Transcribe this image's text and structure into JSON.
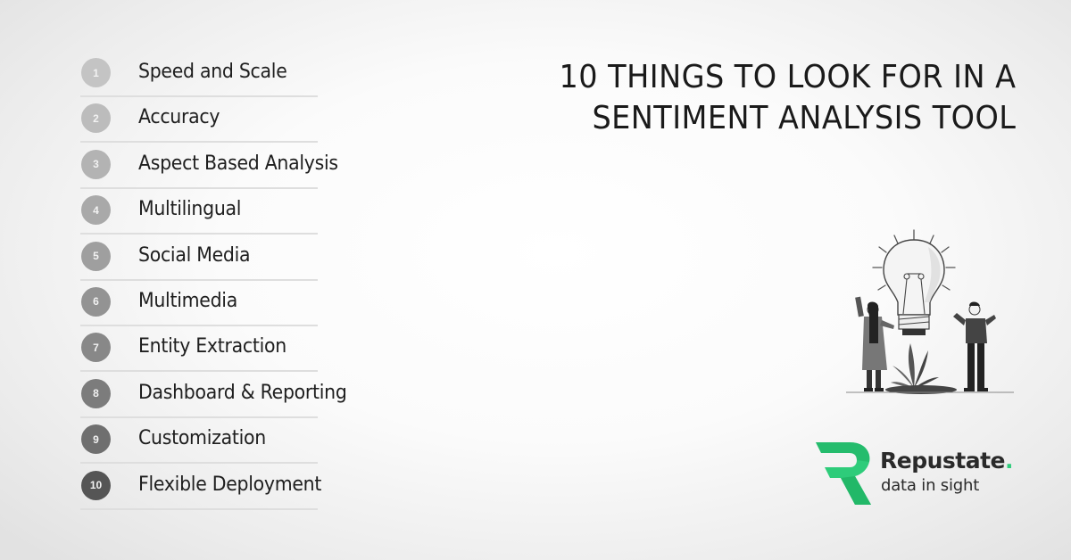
{
  "title": {
    "line1": "10 THINGS TO LOOK FOR IN A",
    "line2": "SENTIMENT ANALYSIS TOOL"
  },
  "list": {
    "items": [
      {
        "number": "1",
        "label": "Speed and Scale",
        "color": "#c4c4c4"
      },
      {
        "number": "2",
        "label": "Accuracy",
        "color": "#bcbcbc"
      },
      {
        "number": "3",
        "label": "Aspect Based Analysis",
        "color": "#b3b3b3"
      },
      {
        "number": "4",
        "label": "Multilingual",
        "color": "#a9a9a9"
      },
      {
        "number": "5",
        "label": "Social Media",
        "color": "#9f9f9f"
      },
      {
        "number": "6",
        "label": "Multimedia",
        "color": "#939393"
      },
      {
        "number": "7",
        "label": "Entity Extraction",
        "color": "#888888"
      },
      {
        "number": "8",
        "label": "Dashboard & Reporting",
        "color": "#7c7c7c"
      },
      {
        "number": "9",
        "label": "Customization",
        "color": "#6f6f6f"
      },
      {
        "number": "10",
        "label": "Flexible Deployment",
        "color": "#555555"
      }
    ]
  },
  "illustration": {
    "icon": "lightbulb-with-people-illustration"
  },
  "logo": {
    "brand": "Repustate",
    "brand_dot": ".",
    "tagline": "data in sight",
    "accent_color": "#2ecc7a"
  }
}
